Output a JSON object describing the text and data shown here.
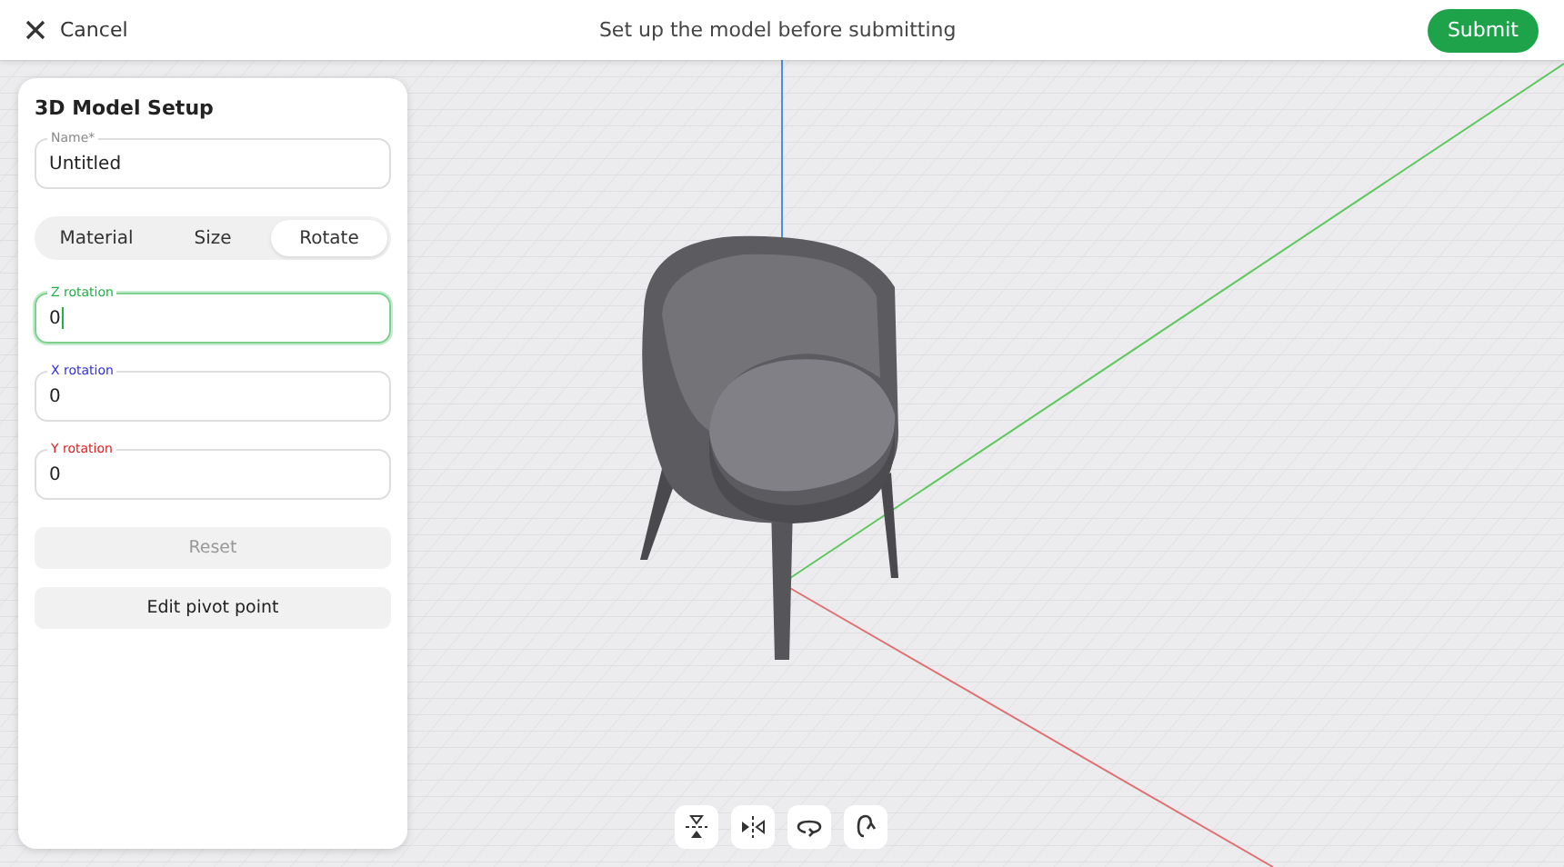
{
  "header": {
    "cancel": "Cancel",
    "title": "Set up the model before submitting",
    "submit": "Submit"
  },
  "panel": {
    "title": "3D Model Setup",
    "name_field": {
      "label": "Name*",
      "value": "Untitled"
    },
    "tabs": [
      {
        "label": "Material",
        "selected": false
      },
      {
        "label": "Size",
        "selected": false
      },
      {
        "label": "Rotate",
        "selected": true
      }
    ],
    "rotation_fields": [
      {
        "label": "Z rotation",
        "value": "0",
        "color": "#22b045",
        "focused": true
      },
      {
        "label": "X rotation",
        "value": "0",
        "color": "#3030e0",
        "focused": false
      },
      {
        "label": "Y rotation",
        "value": "0",
        "color": "#e02020",
        "focused": false
      }
    ],
    "buttons": [
      {
        "label": "Reset",
        "disabled": true
      },
      {
        "label": "Edit pivot point",
        "disabled": false
      }
    ]
  },
  "toolbar": [
    {
      "kind": "flip-vertical"
    },
    {
      "kind": "flip-horizontal"
    },
    {
      "kind": "rotate-horizontal"
    },
    {
      "kind": "rotate-vertical"
    }
  ]
}
